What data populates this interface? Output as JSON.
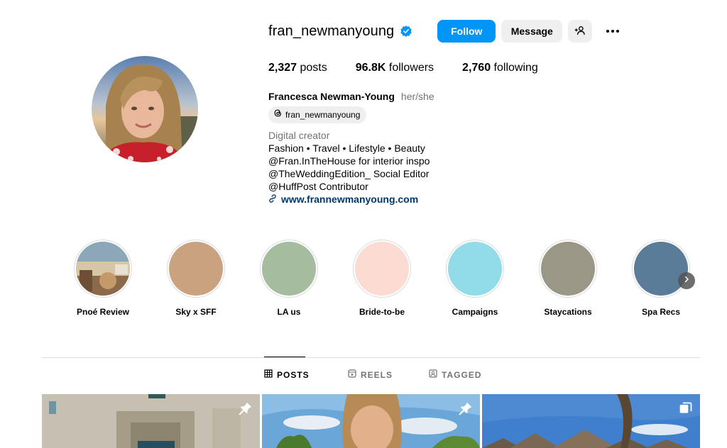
{
  "profile": {
    "username": "fran_newmanyoung",
    "verified": true,
    "follow_label": "Follow",
    "message_label": "Message",
    "stats": {
      "posts_count": "2,327",
      "posts_label": "posts",
      "followers_count": "96.8K",
      "followers_label": "followers",
      "following_count": "2,760",
      "following_label": "following"
    },
    "full_name": "Francesca Newman-Young",
    "pronouns": "her/she",
    "threads_handle": "fran_newmanyoung",
    "category": "Digital creator",
    "bio_lines": [
      "Fashion • Travel • Lifestyle • Beauty",
      "@Fran.InTheHouse for interior inspo",
      "@TheWeddingEdition_ Social Editor",
      "@HuffPost Contributor"
    ],
    "website": "www.frannewmanyoung.com"
  },
  "highlights": [
    {
      "label": "Pnoé Review",
      "color": "#a98a6a"
    },
    {
      "label": "Sky x SFF",
      "color": "#caa27f"
    },
    {
      "label": "LA us",
      "color": "#a6bc9f"
    },
    {
      "label": "Bride-to-be",
      "color": "#fcdcd2"
    },
    {
      "label": "Campaigns",
      "color": "#92dbe8"
    },
    {
      "label": "Staycations",
      "color": "#9a9786"
    },
    {
      "label": "Spa Recs",
      "color": "#5b7c98"
    }
  ],
  "tabs": [
    {
      "label": "POSTS",
      "active": true
    },
    {
      "label": "REELS",
      "active": false
    },
    {
      "label": "TAGGED",
      "active": false
    }
  ],
  "colors": {
    "accent": "#0095f6",
    "link": "#00376b",
    "secondary_text": "#737373",
    "button_bg": "#efefef"
  },
  "icons": {
    "verified": "verified-badge-icon",
    "add_user": "add-user-icon",
    "more": "more-options-icon",
    "threads": "threads-icon",
    "link": "link-icon",
    "next": "chevron-right-icon",
    "posts_tab": "grid-icon",
    "reels_tab": "reels-icon",
    "tagged_tab": "tagged-icon",
    "pinned": "pin-icon",
    "carousel": "carousel-icon"
  }
}
